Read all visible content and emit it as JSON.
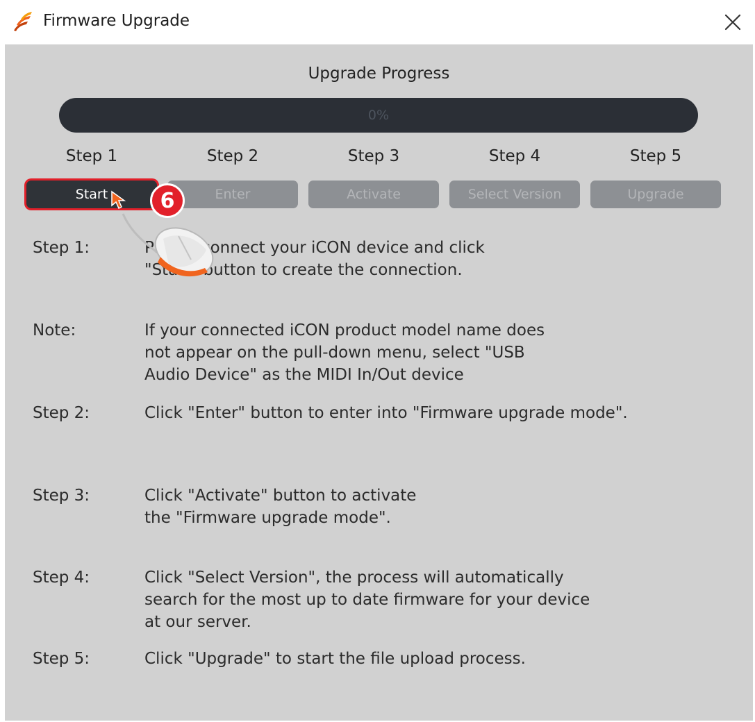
{
  "window": {
    "title": "Firmware Upgrade",
    "close_symbol": "×",
    "logo_icon": "app-logo-icon"
  },
  "progress": {
    "title": "Upgrade Progress",
    "value": 0,
    "text": "0%"
  },
  "steps": [
    {
      "label": "Step 1",
      "button": "Start"
    },
    {
      "label": "Step 2",
      "button": "Enter"
    },
    {
      "label": "Step 3",
      "button": "Activate"
    },
    {
      "label": "Step 4",
      "button": "Select Version"
    },
    {
      "label": "Step 5",
      "button": "Upgrade"
    }
  ],
  "callout": {
    "number": "6",
    "color": "#e2202a"
  },
  "instructions": [
    {
      "label": "Step 1:",
      "lines": [
        "Please connect your iCON device and click",
        "\"Start\" button to create the connection."
      ]
    },
    {
      "label": "Note:",
      "lines": [
        "If your connected iCON product model name does",
        "not appear on the pull-down menu, select \"USB",
        "Audio Device\" as the MIDI In/Out device"
      ]
    },
    {
      "label": "Step 2:",
      "lines": [
        "Click \"Enter\" button to enter into \"Firmware upgrade mode\"."
      ]
    },
    {
      "label": "Step 3:",
      "lines": [
        "Click \"Activate\" button to activate",
        "the \"Firmware upgrade mode\"."
      ]
    },
    {
      "label": "Step 4:",
      "lines": [
        "Click \"Select Version\", the process will automatically",
        "search for the most up to date firmware for your device",
        "at our server."
      ]
    },
    {
      "label": "Step 5:",
      "lines": [
        "Click \"Upgrade\" to start the file upload process."
      ]
    }
  ],
  "colors": {
    "panel": "#d1d1d1",
    "progress_track": "#2b2f36",
    "button_disabled": "#8d9094",
    "button_active": "#2f3338",
    "highlight": "#e2202a",
    "logo_orange": "#f0641e"
  }
}
